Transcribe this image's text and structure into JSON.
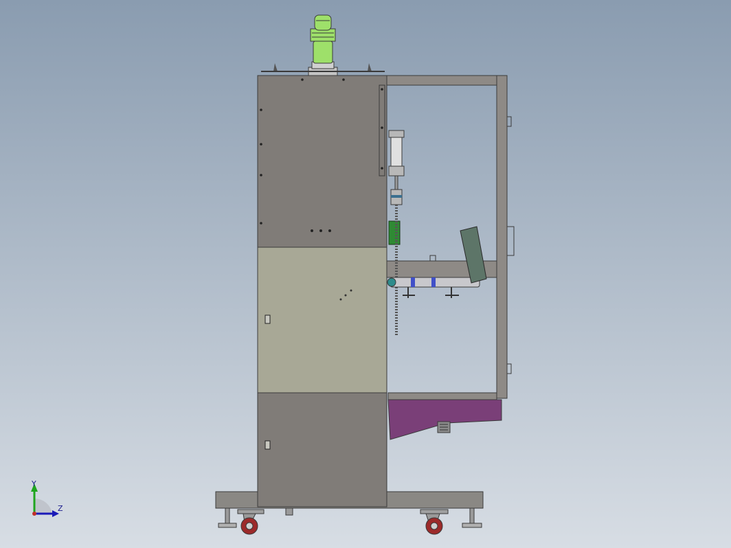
{
  "viewport": {
    "background_top": "#8a9cb0",
    "background_bottom": "#d7dde4"
  },
  "triad": {
    "y_label": "Y",
    "z_label": "Z",
    "y_color": "#1fa51f",
    "z_color": "#1a1ab8"
  },
  "colors": {
    "cabinet_dark": "#807c78",
    "cabinet_light": "#a8a896",
    "frame": "#8e8a86",
    "outline": "#3a3a3a",
    "motor_green": "#9ee06a",
    "hopper_purple": "#7a3f78",
    "chute_green": "#5d7568",
    "caster_red": "#9c2a2a",
    "green_block": "#2f8a34",
    "blue_part": "#4050c8"
  },
  "model": {
    "part_name": "",
    "view": "side"
  }
}
